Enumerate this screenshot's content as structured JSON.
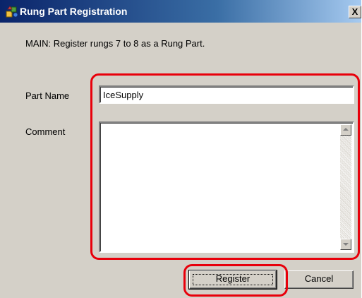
{
  "window": {
    "title": "Rung Part Registration",
    "close_label": "X"
  },
  "description": "MAIN: Register rungs 7 to 8 as a Rung Part.",
  "form": {
    "part_name_label": "Part Name",
    "part_name_value": "IceSupply",
    "comment_label": "Comment",
    "comment_value": ""
  },
  "buttons": {
    "register": "Register",
    "cancel": "Cancel"
  },
  "colors": {
    "highlight": "#e8000b",
    "title_bar": "#0a246a",
    "dialog_bg": "#d4d0c8"
  }
}
